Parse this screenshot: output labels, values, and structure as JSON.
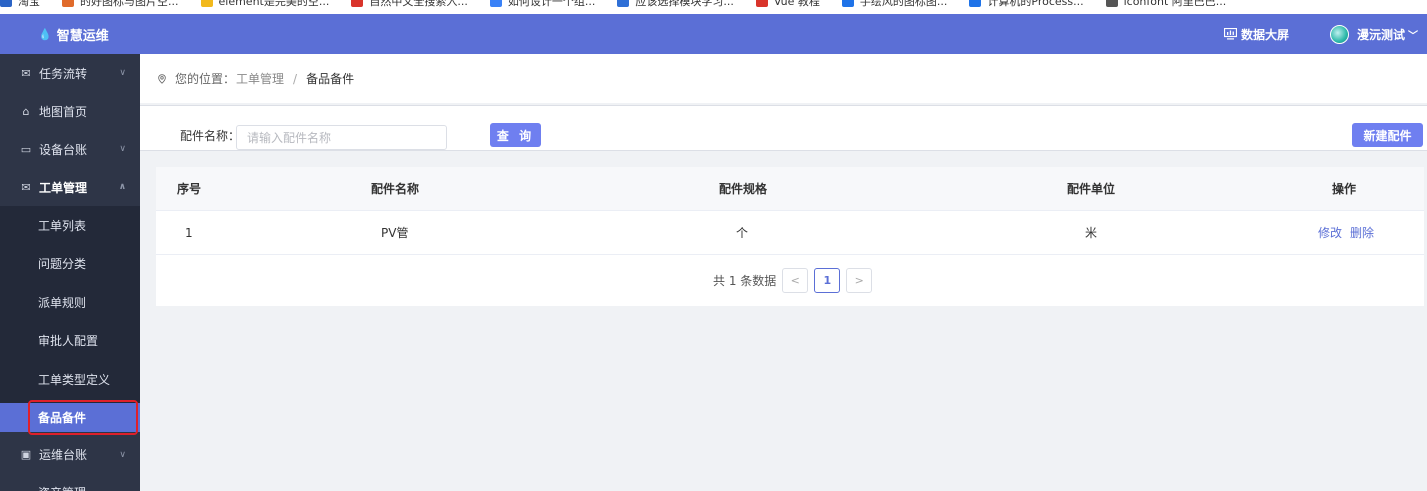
{
  "bookmarks": [
    {
      "label": "淘宝",
      "color": "#2b64c6"
    },
    {
      "label": "的好图标与图片空...",
      "color": "#e06b2b"
    },
    {
      "label": "element是完美的空...",
      "color": "#f2b91c"
    },
    {
      "label": "自然中文全搜索入...",
      "color": "#d9342b"
    },
    {
      "label": "如何设计一个组...",
      "color": "#3a82f7"
    },
    {
      "label": "应该选择模块学习...",
      "color": "#2f6fd6"
    },
    {
      "label": "Vue 教程",
      "color": "#d9342b"
    },
    {
      "label": "手绘风的图标图...",
      "color": "#1f73e8"
    },
    {
      "label": "计算机的Process...",
      "color": "#1f73e8"
    },
    {
      "label": "iconfont 阿里巴巴...",
      "color": "#555555"
    }
  ],
  "header": {
    "app_title": "智慧运维",
    "data_screen_label": "数据大屏",
    "user_name": "漫沅测试",
    "colors": {
      "topbar": "#5b6fd6",
      "sidebar": "#2e3547",
      "accent": "#6f7ff0",
      "highlight": "#e0202a"
    }
  },
  "sidebar": {
    "menus": [
      {
        "label": "任务流转",
        "icon": "envelope-icon",
        "has_children": true,
        "expanded": false
      },
      {
        "label": "地图首页",
        "icon": "home-icon",
        "has_children": false,
        "expanded": false
      },
      {
        "label": "设备台账",
        "icon": "drive-icon",
        "has_children": true,
        "expanded": false
      },
      {
        "label": "工单管理",
        "icon": "envelope-icon",
        "has_children": true,
        "expanded": true
      },
      {
        "label": "运维台账",
        "icon": "image-icon",
        "has_children": true,
        "expanded": false
      }
    ],
    "work_order_children": [
      "工单列表",
      "问题分类",
      "派单规则",
      "审批人配置",
      "工单类型定义",
      "备品备件"
    ],
    "active_child": "备品备件",
    "partial_item": "资产管理"
  },
  "breadcrumb": {
    "label": "您的位置：",
    "parent": "工单管理",
    "separator": "/",
    "current": "备品备件"
  },
  "filter": {
    "name_label": "配件名称：",
    "name_placeholder": "请输入配件名称",
    "name_value": "",
    "query_button": "查 询",
    "new_button": "新建配件"
  },
  "table": {
    "columns": [
      "序号",
      "配件名称",
      "配件规格",
      "配件单位",
      "操作"
    ],
    "rows": [
      {
        "index": "1",
        "name": "PV管",
        "spec": "个",
        "unit": "米",
        "actions": [
          "修改",
          "删除"
        ]
      }
    ]
  },
  "pagination": {
    "total_text": "共 1 条数据",
    "current_page": "1",
    "prev_icon": "chevron-left-icon",
    "next_icon": "chevron-right-icon"
  }
}
